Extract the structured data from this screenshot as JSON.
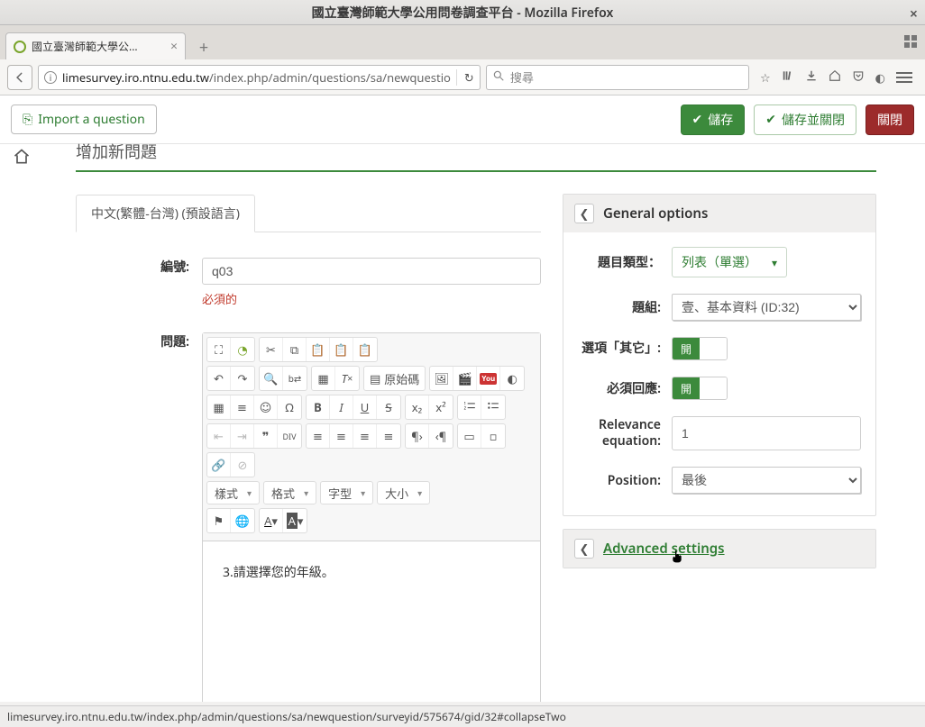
{
  "window": {
    "title": "國立臺灣師範大學公用問卷調查平台 - Mozilla Firefox",
    "tab_title": "國立臺灣師範大學公...",
    "url_host": "limesurvey.iro.ntnu.edu.tw",
    "url_path": "/index.php/admin/questions/sa/newquestio",
    "search_placeholder": "搜尋",
    "status_url": "limesurvey.iro.ntnu.edu.tw/index.php/admin/questions/sa/newquestion/surveyid/575674/gid/32#collapseTwo"
  },
  "actions": {
    "import": "Import a question",
    "save": "儲存",
    "save_close": "儲存並關閉",
    "close": "關閉"
  },
  "page": {
    "heading_partial": "增加新問題",
    "lang_tab": "中文(繁體-台灣) (預設語言)",
    "code_label": "編號:",
    "code_value": "q03",
    "required_note": "必須的",
    "question_label": "問題:",
    "question_text": "3.請選擇您的年級。"
  },
  "editor": {
    "source_label": "原始碼",
    "styles": "樣式",
    "format": "格式",
    "font": "字型",
    "size": "大小"
  },
  "general": {
    "panel_title": "General options",
    "qtype_label": "題目類型：",
    "qtype_value": "列表（單選）",
    "group_label": "題組:",
    "group_value": "壹、基本資料 (ID:32)",
    "other_label": "選項「其它」:",
    "mandatory_label": "必須回應:",
    "toggle_on": "開",
    "relevance_label": "Relevance equation:",
    "relevance_value": "1",
    "position_label": "Position:",
    "position_value": "最後"
  },
  "advanced": {
    "panel_title": "Advanced settings"
  }
}
